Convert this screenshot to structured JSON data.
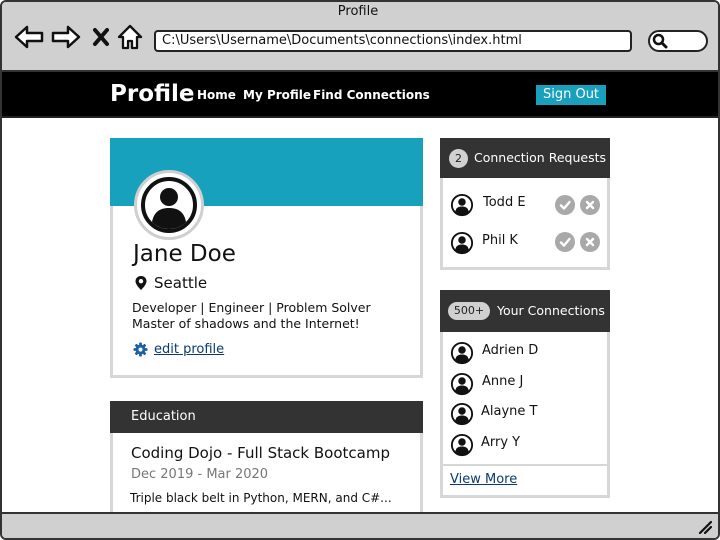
{
  "window": {
    "title": "Profile"
  },
  "browser": {
    "address": "C:\\Users\\Username\\Documents\\connections\\index.html",
    "icons": [
      "back-arrow-icon",
      "forward-arrow-icon",
      "close-x-icon",
      "home-icon",
      "search-icon",
      "resize-grip-icon"
    ]
  },
  "nav": {
    "brand": "Profile",
    "links": [
      "Home",
      "My Profile",
      "Find Connections"
    ],
    "sign_out": "Sign Out"
  },
  "profile": {
    "name": "Jane Doe",
    "location": "Seattle",
    "bio_line1": "Developer | Engineer | Problem Solver",
    "bio_line2": "Master of shadows and the Internet!",
    "edit_label": "edit profile"
  },
  "education": {
    "header": "Education",
    "school": "Coding Dojo - Full Stack Bootcamp",
    "dates": "Dec 2019 - Mar 2020",
    "description": "Triple black belt in Python, MERN, and C#..."
  },
  "requests": {
    "count": "2",
    "title": "Connection Requests",
    "people": [
      "Todd E",
      "Phil K"
    ]
  },
  "connections": {
    "count": "500+",
    "title": "Your Connections",
    "people": [
      "Adrien D",
      "Anne J",
      "Alayne T",
      "Arry Y"
    ],
    "view_more": "View More"
  },
  "colors": {
    "accent": "#17a1bc",
    "nav_bg": "#000000",
    "panel_header": "#333333",
    "chrome": "#d0d0d0",
    "link": "#0b3a6e",
    "action_button": "#a9a9a9"
  }
}
